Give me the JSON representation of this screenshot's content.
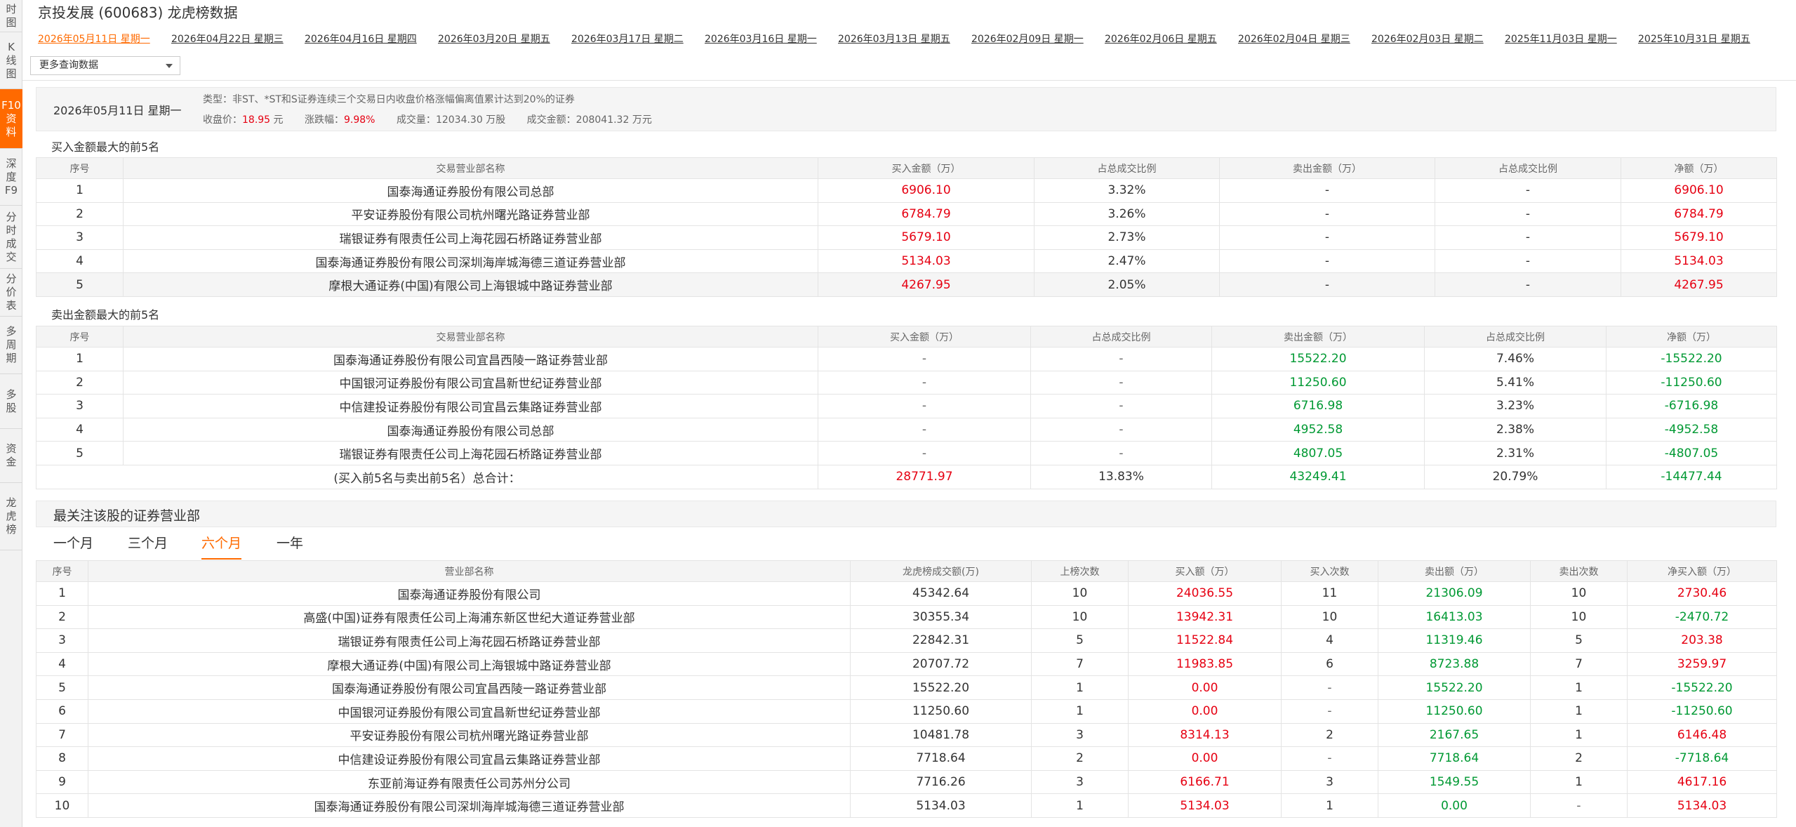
{
  "sidebar": {
    "items": [
      {
        "label": [
          "时",
          "图"
        ]
      },
      {
        "label": [
          "K",
          "线",
          "图"
        ]
      },
      {
        "label": [
          "F10",
          "资",
          "料"
        ]
      },
      {
        "label": [
          "深",
          "度",
          "F9"
        ]
      },
      {
        "label": [
          "分",
          "时",
          "成",
          "交"
        ]
      },
      {
        "label": [
          "分",
          "价",
          "表"
        ]
      },
      {
        "label": [
          "多",
          "周",
          "期"
        ]
      },
      {
        "label": [
          "多",
          "股"
        ]
      },
      {
        "label": [
          "资",
          "金"
        ]
      },
      {
        "label": [
          "龙",
          "虎",
          "榜"
        ]
      }
    ],
    "active_index": 2
  },
  "header": {
    "title": "京投发展 (600683)  龙虎榜数据",
    "date_tabs": [
      "2026年05月11日 星期一",
      "2026年04月22日 星期三",
      "2026年04月16日 星期四",
      "2026年03月20日 星期五",
      "2026年03月17日 星期二",
      "2026年03月16日 星期一",
      "2026年03月13日 星期五",
      "2026年02月09日 星期一",
      "2026年02月06日 星期五",
      "2026年02月04日 星期三",
      "2026年02月03日 星期二",
      "2025年11月03日 星期一",
      "2025年10月31日 星期五"
    ],
    "active_date_index": 0,
    "more_select": "更多查询数据"
  },
  "summary": {
    "date": "2026年05月11日 星期一",
    "type_label": "类型：",
    "type_text": "非ST、*ST和S证券连续三个交易日内收盘价格涨幅偏离值累计达到20%的证券",
    "close_label": "收盘价：",
    "close_value": "18.95",
    "close_unit": " 元",
    "change_label": "涨跌幅：",
    "change_value": "9.98%",
    "volume_label": "成交量：",
    "volume_value": "12034.30 万股",
    "amount_label": "成交金额：",
    "amount_value": "208041.32 万元"
  },
  "buy_section": {
    "title": "买入金额最大的前5名",
    "headers": [
      "序号",
      "交易营业部名称",
      "买入金额（万）",
      "占总成交比例",
      "卖出金额（万）",
      "占总成交比例",
      "净额（万）"
    ],
    "rows": [
      [
        "1",
        "国泰海通证券股份有限公司总部",
        "6906.10",
        "3.32%",
        "-",
        "-",
        "6906.10"
      ],
      [
        "2",
        "平安证券股份有限公司杭州曙光路证券营业部",
        "6784.79",
        "3.26%",
        "-",
        "-",
        "6784.79"
      ],
      [
        "3",
        "瑞银证券有限责任公司上海花园石桥路证券营业部",
        "5679.10",
        "2.73%",
        "-",
        "-",
        "5679.10"
      ],
      [
        "4",
        "国泰海通证券股份有限公司深圳海岸城海德三道证券营业部",
        "5134.03",
        "2.47%",
        "-",
        "-",
        "5134.03"
      ],
      [
        "5",
        "摩根大通证券(中国)有限公司上海银城中路证券营业部",
        "4267.95",
        "2.05%",
        "-",
        "-",
        "4267.95"
      ]
    ]
  },
  "sell_section": {
    "title": "卖出金额最大的前5名",
    "headers": [
      "序号",
      "交易营业部名称",
      "买入金额（万）",
      "占总成交比例",
      "卖出金额（万）",
      "占总成交比例",
      "净额（万）"
    ],
    "rows": [
      [
        "1",
        "国泰海通证券股份有限公司宜昌西陵一路证券营业部",
        "-",
        "-",
        "15522.20",
        "7.46%",
        "-15522.20"
      ],
      [
        "2",
        "中国银河证券股份有限公司宜昌新世纪证券营业部",
        "-",
        "-",
        "11250.60",
        "5.41%",
        "-11250.60"
      ],
      [
        "3",
        "中信建投证券股份有限公司宜昌云集路证券营业部",
        "-",
        "-",
        "6716.98",
        "3.23%",
        "-6716.98"
      ],
      [
        "4",
        "国泰海通证券股份有限公司总部",
        "-",
        "-",
        "4952.58",
        "2.38%",
        "-4952.58"
      ],
      [
        "5",
        "瑞银证券有限责任公司上海花园石桥路证券营业部",
        "-",
        "-",
        "4807.05",
        "2.31%",
        "-4807.05"
      ]
    ],
    "total": [
      "(买入前5名与卖出前5名）总合计：",
      "28771.97",
      "13.83%",
      "43249.41",
      "20.79%",
      "-14477.44"
    ]
  },
  "focus_section": {
    "title": "最关注该股的证券营业部",
    "periods": [
      "一个月",
      "三个月",
      "六个月",
      "一年"
    ],
    "active_period_index": 2,
    "headers": [
      "序号",
      "营业部名称",
      "龙虎榜成交额(万)",
      "上榜次数",
      "买入额（万）",
      "买入次数",
      "卖出额（万）",
      "卖出次数",
      "净买入额（万）"
    ],
    "rows": [
      [
        "1",
        "国泰海通证券股份有限公司",
        "45342.64",
        "10",
        "24036.55",
        "11",
        "21306.09",
        "10",
        "2730.46"
      ],
      [
        "2",
        "高盛(中国)证券有限责任公司上海浦东新区世纪大道证券营业部",
        "30355.34",
        "10",
        "13942.31",
        "10",
        "16413.03",
        "10",
        "-2470.72"
      ],
      [
        "3",
        "瑞银证券有限责任公司上海花园石桥路证券营业部",
        "22842.31",
        "5",
        "11522.84",
        "4",
        "11319.46",
        "5",
        "203.38"
      ],
      [
        "4",
        "摩根大通证券(中国)有限公司上海银城中路证券营业部",
        "20707.72",
        "7",
        "11983.85",
        "6",
        "8723.88",
        "7",
        "3259.97"
      ],
      [
        "5",
        "国泰海通证券股份有限公司宜昌西陵一路证券营业部",
        "15522.20",
        "1",
        "0.00",
        "-",
        "15522.20",
        "1",
        "-15522.20"
      ],
      [
        "6",
        "中国银河证券股份有限公司宜昌新世纪证券营业部",
        "11250.60",
        "1",
        "0.00",
        "-",
        "11250.60",
        "1",
        "-11250.60"
      ],
      [
        "7",
        "平安证券股份有限公司杭州曙光路证券营业部",
        "10481.78",
        "3",
        "8314.13",
        "2",
        "2167.65",
        "1",
        "6146.48"
      ],
      [
        "8",
        "中信建设证券股份有限公司宜昌云集路证券营业部",
        "7718.64",
        "2",
        "0.00",
        "-",
        "7718.64",
        "2",
        "-7718.64"
      ],
      [
        "9",
        "东亚前海证券有限责任公司苏州分公司",
        "7716.26",
        "3",
        "6166.71",
        "3",
        "1549.55",
        "1",
        "4617.16"
      ],
      [
        "10",
        "国泰海通证券股份有限公司深圳海岸城海德三道证券营业部",
        "5134.03",
        "1",
        "5134.03",
        "1",
        "0.00",
        "-",
        "5134.03"
      ]
    ]
  },
  "colors": {
    "accent": "#ff6a00",
    "up": "#e60012",
    "down": "#009933"
  }
}
